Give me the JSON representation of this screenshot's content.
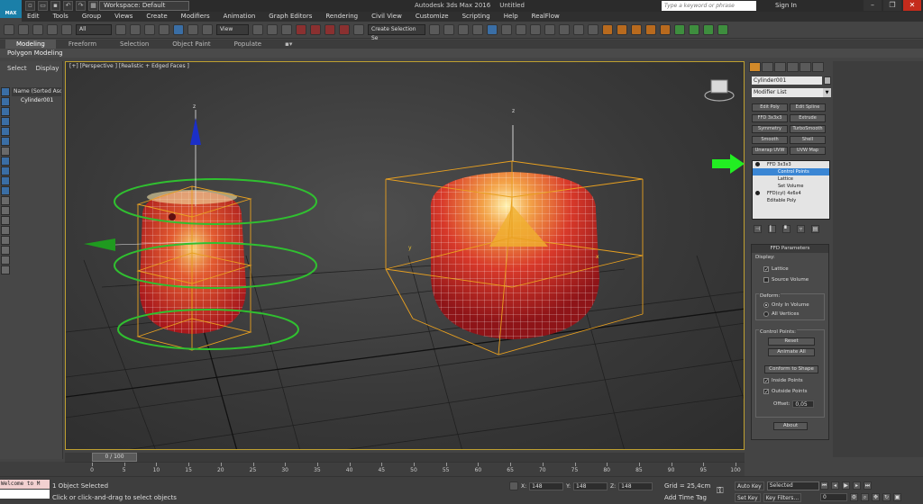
{
  "app": {
    "logo_label": "MAX",
    "workspace": "Workspace: Default",
    "title": "Autodesk 3ds Max 2016",
    "file": "Untitled",
    "search_placeholder": "Type a keyword or phrase",
    "signin": "Sign In",
    "help": "?"
  },
  "menu": [
    "Edit",
    "Tools",
    "Group",
    "Views",
    "Create",
    "Modifiers",
    "Animation",
    "Graph Editors",
    "Rendering",
    "Civil View",
    "Customize",
    "Scripting",
    "Help",
    "RealFlow"
  ],
  "toolbar": {
    "filter": "All",
    "refcoord": "View",
    "named_selection": "Create Selection Se"
  },
  "ribbon": {
    "tabs": [
      "Modeling",
      "Freeform",
      "Selection",
      "Object Paint",
      "Populate"
    ],
    "active_tab": "Modeling",
    "sub": "Polygon Modeling"
  },
  "explorer": {
    "tabs": [
      "Select",
      "Display"
    ],
    "header": "Name (Sorted Ascer",
    "item": "Cylinder001"
  },
  "viewport": {
    "label": "[+] [Perspective ] [Realistic + Edged Faces ]",
    "axis_z": "z",
    "axis_y": "y",
    "axis_x": "x"
  },
  "timeline": {
    "slider": "0 / 100",
    "ticks": [
      "0",
      "5",
      "10",
      "15",
      "20",
      "25",
      "30",
      "35",
      "40",
      "45",
      "50",
      "55",
      "60",
      "65",
      "70",
      "75",
      "80",
      "85",
      "90",
      "95",
      "100"
    ]
  },
  "status": {
    "maxscript": "Welcome to M",
    "selected": "1 Object Selected",
    "hint": "Click or click-and-drag to select objects",
    "x_label": "X:",
    "x_value": "148",
    "y_label": "Y:",
    "y_value": "148",
    "z_label": "Z:",
    "z_value": "148",
    "grid": "Grid = 25,4cm",
    "add_time_tag": "Add Time Tag",
    "auto_key": "Auto Key",
    "selected_dropdown": "Selected",
    "set_key": "Set Key",
    "key_filters": "Key Filters...",
    "frame": "0"
  },
  "command_panel": {
    "object_name": "Cylinder001",
    "modifier_list": "Modifier List",
    "mod_buttons": [
      "Edit Poly",
      "Edit Spline",
      "FFD 3x3x3",
      "Extrude",
      "Symmetry",
      "TurboSmooth",
      "Smooth",
      "Shell",
      "Unwrap UVW",
      "UVW Map"
    ],
    "stack": [
      {
        "label": "FFD 3x3x3",
        "level": 0,
        "highlight": false
      },
      {
        "label": "Control Points",
        "level": 1,
        "highlight": true
      },
      {
        "label": "Lattice",
        "level": 1,
        "highlight": false
      },
      {
        "label": "Set Volume",
        "level": 1,
        "highlight": false
      },
      {
        "label": "FFD(cyl) 4x6x4",
        "level": 0,
        "highlight": false
      },
      {
        "label": "Editable Poly",
        "level": 0,
        "highlight": false
      }
    ],
    "rollout_title": "FFD Parameters",
    "display_label": "Display:",
    "lattice": "Lattice",
    "source_volume": "Source Volume",
    "deform_label": "Deform:",
    "only_in_volume": "Only In Volume",
    "all_vertices": "All Vertices",
    "control_points_label": "Control Points:",
    "reset": "Reset",
    "animate_all": "Animate All",
    "conform": "Conform to Shape",
    "inside_points": "Inside Points",
    "outside_points": "Outside Points",
    "offset_label": "Offset:",
    "offset_value": "0,05",
    "about": "About"
  },
  "colors": {
    "accent": "#3a86d4",
    "lattice": "#e8a020",
    "gizmo": "#30c030",
    "pointer_arrow": "#22ee22"
  }
}
